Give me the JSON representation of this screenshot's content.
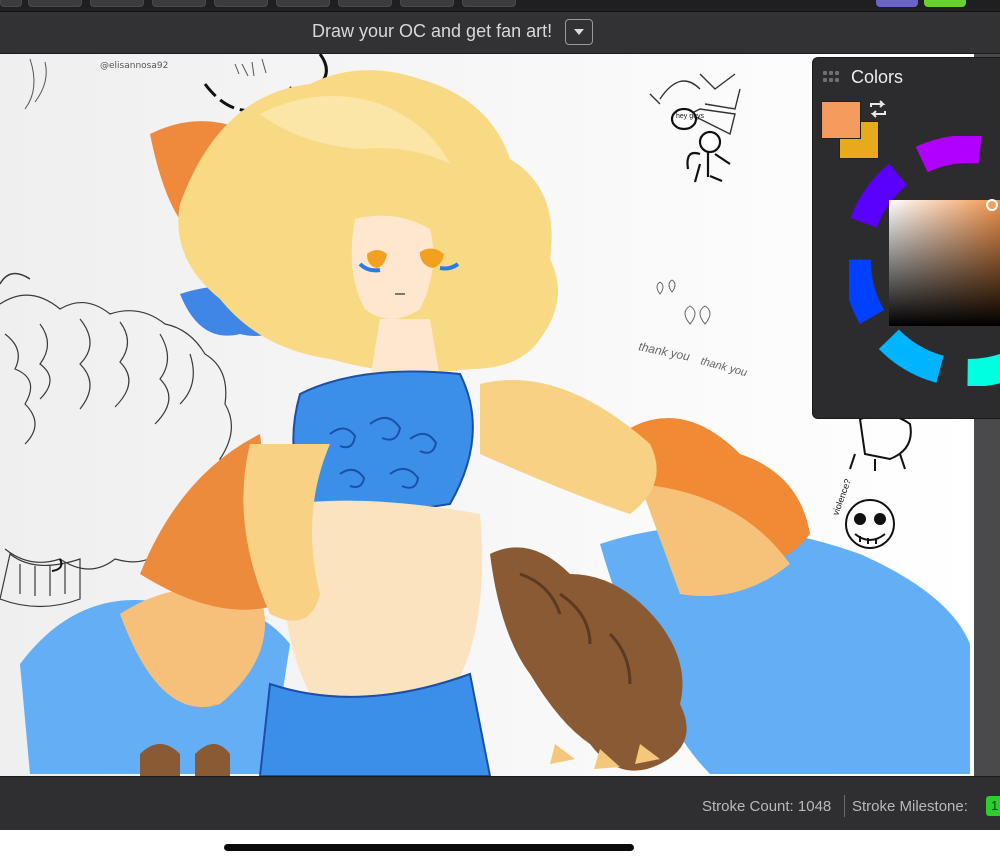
{
  "room": {
    "title": "Draw your OC and get fan art!"
  },
  "colors_panel": {
    "title": "Colors",
    "primary_color": "#f49c5e",
    "secondary_color": "#e8aa1c",
    "swap_icon": "swap-arrows-icon"
  },
  "status": {
    "stroke_count_label": "Stroke Count: 1048",
    "stroke_milestone_label": "Stroke Milestone:",
    "milestone_badge": "1"
  },
  "canvas_text": {
    "speech": "hey guys",
    "thanks_1": "thank you",
    "thanks_2": "thank you",
    "question": "violence?",
    "signature": "@elisannosa92"
  },
  "palette": {
    "accent_orange": "#f49c5e",
    "accent_yellow": "#e8aa1c",
    "badge_green": "#27d12a",
    "top_swatch_purple": "#6a63c8",
    "top_swatch_green": "#6ad12a"
  }
}
